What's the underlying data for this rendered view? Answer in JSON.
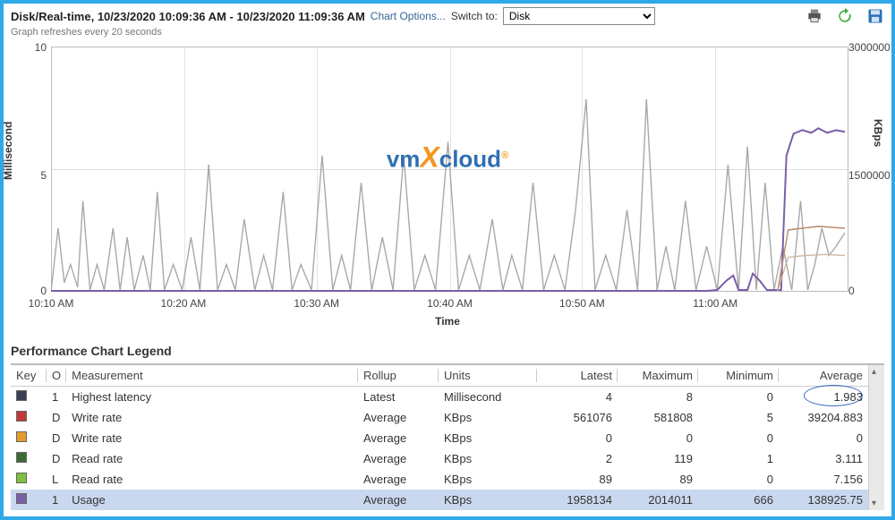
{
  "header": {
    "title": "Disk/Real-time, 10/23/2020 10:09:36 AM - 10/23/2020 11:09:36 AM",
    "chart_options": "Chart Options...",
    "switch_to": "Switch to:",
    "select_value": "Disk"
  },
  "refresh_note": "Graph refreshes every 20 seconds",
  "axes": {
    "ylabel_left": "Millisecond",
    "ylabel_right": "KBps",
    "xlabel": "Time",
    "ytick_l_top": "10",
    "ytick_l_mid": "5",
    "ytick_l_bot": "0",
    "ytick_r_top": "3000000",
    "ytick_r_mid": "1500000",
    "ytick_r_bot": "0",
    "xticks": [
      "10:10 AM",
      "10:20 AM",
      "10:30 AM",
      "10:40 AM",
      "10:50 AM",
      "11:00 AM"
    ]
  },
  "icons": {
    "print": "printer-icon",
    "refresh": "refresh-icon",
    "save": "save-icon"
  },
  "legend_title": "Performance Chart Legend",
  "legend_headers": {
    "key": "Key",
    "obj": "O",
    "measurement": "Measurement",
    "rollup": "Rollup",
    "units": "Units",
    "latest": "Latest",
    "maximum": "Maximum",
    "minimum": "Minimum",
    "average": "Average"
  },
  "legend_rows": [
    {
      "color": "#3A3F55",
      "obj": "1",
      "measurement": "Highest latency",
      "rollup": "Latest",
      "units": "Millisecond",
      "latest": "4",
      "maximum": "8",
      "minimum": "0",
      "average": "1.983",
      "circled": true
    },
    {
      "color": "#C03A3A",
      "obj": "D",
      "measurement": "Write rate",
      "rollup": "Average",
      "units": "KBps",
      "latest": "561076",
      "maximum": "581808",
      "minimum": "5",
      "average": "39204.883"
    },
    {
      "color": "#E39B2E",
      "obj": "D",
      "measurement": "Write rate",
      "rollup": "Average",
      "units": "KBps",
      "latest": "0",
      "maximum": "0",
      "minimum": "0",
      "average": "0"
    },
    {
      "color": "#3E6B34",
      "obj": "D",
      "measurement": "Read rate",
      "rollup": "Average",
      "units": "KBps",
      "latest": "2",
      "maximum": "119",
      "minimum": "1",
      "average": "3.111"
    },
    {
      "color": "#7FBF3F",
      "obj": "L",
      "measurement": "Read rate",
      "rollup": "Average",
      "units": "KBps",
      "latest": "89",
      "maximum": "89",
      "minimum": "0",
      "average": "7.156"
    },
    {
      "color": "#7A5FA8",
      "obj": "1",
      "measurement": "Usage",
      "rollup": "Average",
      "units": "KBps",
      "latest": "1958134",
      "maximum": "2014011",
      "minimum": "666",
      "average": "138925.75",
      "selected": true
    }
  ],
  "chart_data": {
    "type": "line",
    "xlabel": "Time",
    "x_range_minutes": [
      10,
      70
    ],
    "x_tick_labels": [
      "10:10 AM",
      "10:20 AM",
      "10:30 AM",
      "10:40 AM",
      "10:50 AM",
      "11:00 AM"
    ],
    "y_left": {
      "label": "Millisecond",
      "range": [
        0,
        10
      ],
      "ticks": [
        0,
        5,
        10
      ]
    },
    "y_right": {
      "label": "KBps",
      "range": [
        0,
        3000000
      ],
      "ticks": [
        0,
        1500000,
        3000000
      ]
    },
    "series": [
      {
        "name": "Highest latency",
        "axis": "left",
        "color": "#9E9E9E",
        "notes": "spiky millisecond latency roughly 0–8 ms across the hour",
        "summary": {
          "latest": 4,
          "max": 8,
          "min": 0,
          "avg": 1.983
        }
      },
      {
        "name": "Usage",
        "axis": "right",
        "color": "#7A5FA8",
        "notes": "near 0 KBps until ~11:05 AM with two small bumps ~10:58–11:02, then steps up and holds ~1.9–2.0 million KBps",
        "summary": {
          "latest": 1958134,
          "max": 2014011,
          "min": 666,
          "avg": 138925.75
        }
      },
      {
        "name": "Write rate (D, red)",
        "axis": "right",
        "color": "#C03A3A",
        "notes": "mostly ~0; rises late window to ~560k–580k KBps",
        "summary": {
          "latest": 561076,
          "max": 581808,
          "min": 5,
          "avg": 39204.883
        }
      },
      {
        "name": "Write rate (D, orange)",
        "axis": "right",
        "color": "#E39B2E",
        "notes": "flat 0",
        "summary": {
          "latest": 0,
          "max": 0,
          "min": 0,
          "avg": 0
        }
      },
      {
        "name": "Read rate (D)",
        "axis": "right",
        "color": "#3E6B34",
        "notes": "tiny, ~0–119 KBps",
        "summary": {
          "latest": 2,
          "max": 119,
          "min": 1,
          "avg": 3.111
        }
      },
      {
        "name": "Read rate (L)",
        "axis": "right",
        "color": "#7FBF3F",
        "notes": "tiny, ~0–89 KBps",
        "summary": {
          "latest": 89,
          "max": 89,
          "min": 0,
          "avg": 7.156
        }
      }
    ]
  }
}
